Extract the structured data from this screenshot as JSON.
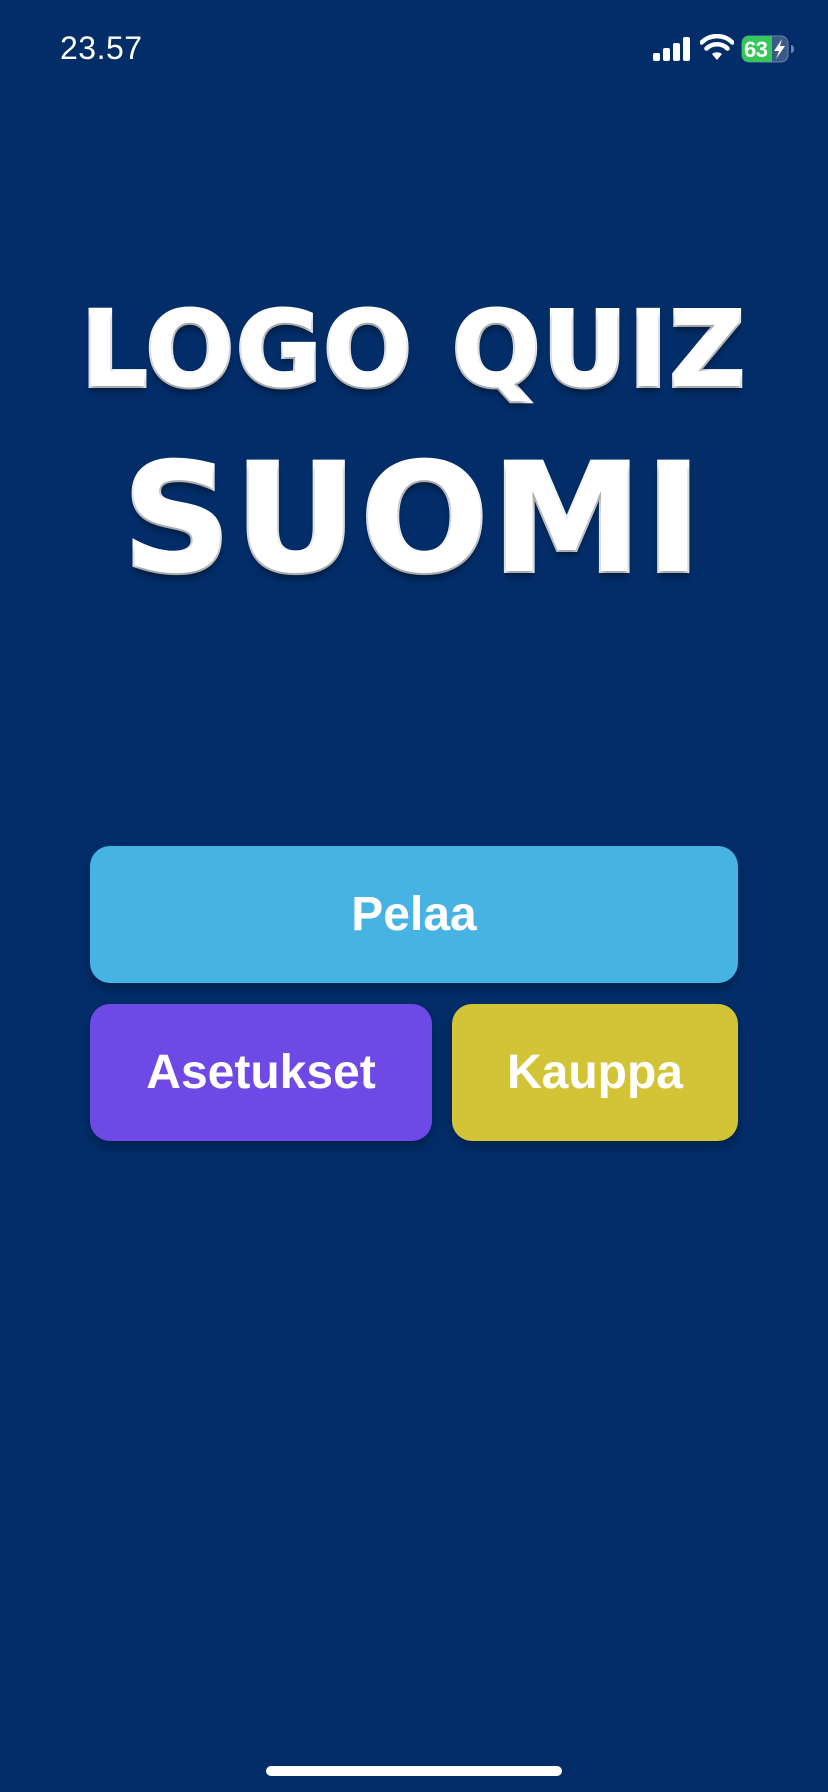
{
  "status_bar": {
    "time": "23.57",
    "battery_level": "63",
    "battery_color": "#34c759",
    "icons": [
      "signal-icon",
      "wifi-icon",
      "battery-charging-icon"
    ]
  },
  "logo": {
    "line1": "LOGO QUIZ",
    "line2": "SUOMI"
  },
  "menu": {
    "play_label": "Pelaa",
    "settings_label": "Asetukset",
    "shop_label": "Kauppa"
  },
  "colors": {
    "background": "#022d68",
    "play": "#47b3e3",
    "settings": "#6e49e6",
    "shop": "#d3c437"
  }
}
